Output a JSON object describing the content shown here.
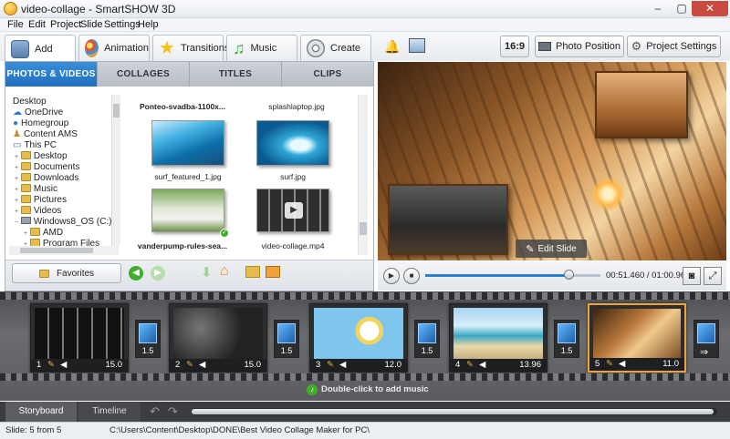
{
  "window": {
    "title": "video-collage - SmartSHOW 3D",
    "min": "–",
    "max": "▢",
    "close": "✕"
  },
  "menu": [
    "File",
    "Edit",
    "Project",
    "Slide",
    "Settings",
    "Help"
  ],
  "main_tabs": [
    {
      "label": "Add",
      "icon": "add-folder-icon",
      "color": "#6b8fb8"
    },
    {
      "label": "Animation",
      "icon": "palette-icon",
      "color": "#d98a3a"
    },
    {
      "label": "Transitions",
      "icon": "star-icon",
      "color": "#f2c21a"
    },
    {
      "label": "Music",
      "icon": "music-note-icon",
      "color": "#3fa83a"
    },
    {
      "label": "Create",
      "icon": "film-reel-icon",
      "color": "#7b7f86"
    }
  ],
  "right_toolbar": {
    "aspect": "16:9",
    "photo_position": "Photo Position",
    "project_settings": "Project Settings"
  },
  "sub_tabs": [
    "PHOTOS & VIDEOS",
    "COLLAGES",
    "TITLES",
    "CLIPS"
  ],
  "tree": [
    {
      "label": "Desktop",
      "indent": 0,
      "icon": "desktop",
      "exp": ""
    },
    {
      "label": "OneDrive",
      "indent": 0,
      "icon": "cloud",
      "exp": ""
    },
    {
      "label": "Homegroup",
      "indent": 0,
      "icon": "homegroup",
      "exp": ""
    },
    {
      "label": "Content AMS",
      "indent": 0,
      "icon": "user",
      "exp": ""
    },
    {
      "label": "This PC",
      "indent": 0,
      "icon": "pc",
      "exp": "▼"
    },
    {
      "label": "Desktop",
      "indent": 1,
      "icon": "folder",
      "exp": "+"
    },
    {
      "label": "Documents",
      "indent": 1,
      "icon": "folder",
      "exp": "+"
    },
    {
      "label": "Downloads",
      "indent": 1,
      "icon": "folder",
      "exp": "+"
    },
    {
      "label": "Music",
      "indent": 1,
      "icon": "folder",
      "exp": "+"
    },
    {
      "label": "Pictures",
      "indent": 1,
      "icon": "folder",
      "exp": "+"
    },
    {
      "label": "Videos",
      "indent": 1,
      "icon": "folder",
      "exp": "+"
    },
    {
      "label": "Windows8_OS (C:)",
      "indent": 1,
      "icon": "drive",
      "exp": "−"
    },
    {
      "label": "AMD",
      "indent": 2,
      "icon": "folder",
      "exp": "+"
    },
    {
      "label": "Program Files",
      "indent": 2,
      "icon": "folder",
      "exp": "+"
    }
  ],
  "files": [
    {
      "name": "Ponteo-svadba-1100x...",
      "bold": true
    },
    {
      "name": "splashlaptop.jpg",
      "bold": false
    },
    {
      "name": "surf_featured_1.jpg",
      "bold": false
    },
    {
      "name": "surf.jpg",
      "bold": false
    },
    {
      "name": "vanderpump-rules-sea...",
      "bold": true
    },
    {
      "name": "video-collage.mp4",
      "bold": false
    }
  ],
  "favorites_label": "Favorites",
  "preview": {
    "edit_slide": "Edit Slide"
  },
  "player": {
    "time": "00:51.460 / 01:00.960",
    "progress": 0.82
  },
  "slides": [
    {
      "num": "1",
      "duration": "15.0",
      "selected": false
    },
    {
      "num": "2",
      "duration": "15.0",
      "selected": false
    },
    {
      "num": "3",
      "duration": "12.0",
      "selected": false
    },
    {
      "num": "4",
      "duration": "13.96",
      "selected": false
    },
    {
      "num": "5",
      "duration": "11.0",
      "selected": true
    }
  ],
  "transitions": [
    "1.5",
    "1.5",
    "1.5",
    "1.5"
  ],
  "music_hint": "Double-click to add music",
  "bottom_tabs": [
    "Storyboard",
    "Timeline"
  ],
  "status": {
    "slide": "Slide: 5 from 5",
    "path": "C:\\Users\\Content\\Desktop\\DONE\\Best Video Collage Maker for PC\\"
  },
  "colors": {
    "accent": "#2a7fd0",
    "selected_slide": "#f0a23a",
    "green": "#3fae2a",
    "orange": "#f08a1a"
  }
}
